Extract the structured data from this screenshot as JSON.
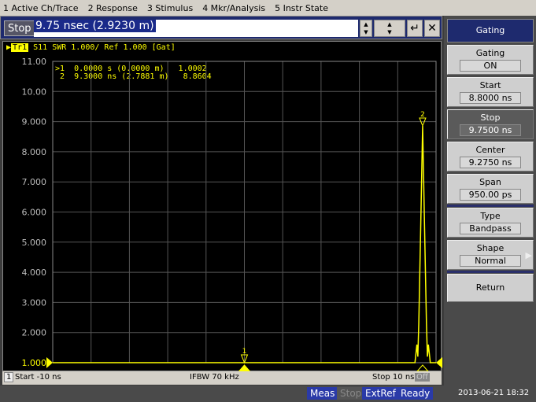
{
  "menu": [
    "1 Active Ch/Trace",
    "2 Response",
    "3 Stimulus",
    "4 Mkr/Analysis",
    "5 Instr State"
  ],
  "entry": {
    "label": "Stop",
    "value": "9.75 nsec (2.9230 m)"
  },
  "trace_header": {
    "id": "Tr1",
    "text": "S11  SWR 1.000/ Ref 1.000 [Gat]"
  },
  "markers": [
    {
      "label": ">1",
      "text": "0.0000 s (0.0000 m)",
      "value": "1.0002"
    },
    {
      "label": " 2",
      "text": "9.3000 ns (2.7881 m)",
      "value": "8.8604"
    }
  ],
  "chart_data": {
    "type": "line",
    "xlabel": "",
    "ylabel": "",
    "xlim": [
      -10,
      10
    ],
    "ylim": [
      1,
      11
    ],
    "y_ticks": [
      "11.00",
      "10.00",
      "9.000",
      "8.000",
      "7.000",
      "6.000",
      "5.000",
      "4.000",
      "3.000",
      "2.000",
      "1.000"
    ],
    "grid": true,
    "color": "#ffff00",
    "series": [
      {
        "x": [
          -10,
          8.9,
          9.0,
          9.05,
          9.1,
          9.2,
          9.3,
          9.4,
          9.5,
          9.55,
          9.6,
          9.7,
          10
        ],
        "y": [
          1,
          1,
          1.6,
          1.2,
          2.3,
          5.5,
          8.86,
          5.5,
          2.3,
          1.2,
          1.6,
          1,
          1
        ]
      }
    ],
    "marker_positions": [
      {
        "id": "1",
        "x": 0,
        "y": 1.0002
      },
      {
        "id": "2",
        "x": 9.3,
        "y": 8.8604
      }
    ]
  },
  "status": {
    "channel": "1",
    "start": "Start -10 ns",
    "ifbw": "IFBW 70 kHz",
    "stop": "Stop 10 ns",
    "off": "Off"
  },
  "bottom": {
    "meas": "Meas",
    "stop": "Stop",
    "extref": "ExtRef",
    "ready": "Ready",
    "time": "2013-06-21 18:32"
  },
  "softkeys": {
    "title": "Gating",
    "items": [
      {
        "label": "Gating",
        "value": "ON"
      },
      {
        "label": "Start",
        "value": "8.8000 ns"
      },
      {
        "label": "Stop",
        "value": "9.7500 ns"
      },
      {
        "label": "Center",
        "value": "9.2750 ns"
      },
      {
        "label": "Span",
        "value": "950.00 ps"
      },
      {
        "label": "Type",
        "value": "Bandpass"
      },
      {
        "label": "Shape",
        "value": "Normal"
      }
    ],
    "return": "Return"
  },
  "colors": {
    "trace": "#ffff00",
    "accent": "#1e2a6e"
  }
}
